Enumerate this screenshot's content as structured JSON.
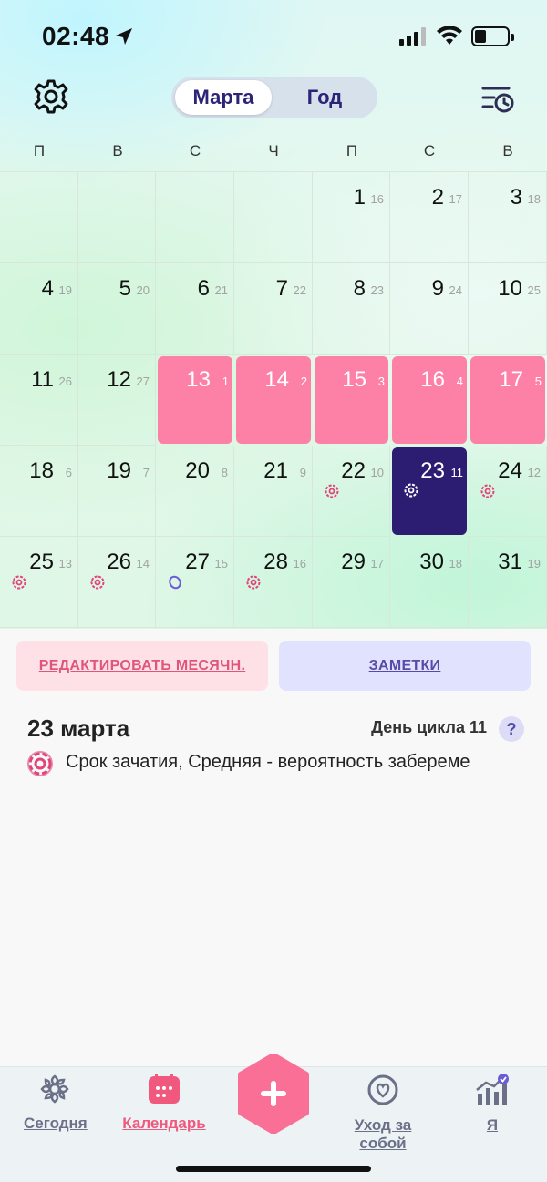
{
  "status": {
    "time": "02:48"
  },
  "header": {
    "segments": [
      {
        "label": "Марта",
        "active": true
      },
      {
        "label": "Год",
        "active": false
      }
    ]
  },
  "weekdays": [
    "П",
    "В",
    "С",
    "Ч",
    "П",
    "С",
    "В"
  ],
  "calendar": {
    "month": "March",
    "accent_period": "#fd80a6",
    "accent_today": "#2d1d72",
    "weeks": [
      [
        null,
        null,
        null,
        null,
        {
          "d": "1",
          "c": "16"
        },
        {
          "d": "2",
          "c": "17"
        },
        {
          "d": "3",
          "c": "18"
        }
      ],
      [
        {
          "d": "4",
          "c": "19"
        },
        {
          "d": "5",
          "c": "20"
        },
        {
          "d": "6",
          "c": "21"
        },
        {
          "d": "7",
          "c": "22"
        },
        {
          "d": "8",
          "c": "23"
        },
        {
          "d": "9",
          "c": "24"
        },
        {
          "d": "10",
          "c": "25"
        }
      ],
      [
        {
          "d": "11",
          "c": "26"
        },
        {
          "d": "12",
          "c": "27"
        },
        {
          "d": "13",
          "c": "1",
          "period": true
        },
        {
          "d": "14",
          "c": "2",
          "period": true
        },
        {
          "d": "15",
          "c": "3",
          "period": true
        },
        {
          "d": "16",
          "c": "4",
          "period": true
        },
        {
          "d": "17",
          "c": "5",
          "period": true
        }
      ],
      [
        {
          "d": "18",
          "c": "6"
        },
        {
          "d": "19",
          "c": "7"
        },
        {
          "d": "20",
          "c": "8"
        },
        {
          "d": "21",
          "c": "9"
        },
        {
          "d": "22",
          "c": "10",
          "marker": "flower"
        },
        {
          "d": "23",
          "c": "11",
          "today": true,
          "marker": "flower"
        },
        {
          "d": "24",
          "c": "12",
          "marker": "flower"
        }
      ],
      [
        {
          "d": "25",
          "c": "13",
          "marker": "flower"
        },
        {
          "d": "26",
          "c": "14",
          "marker": "flower"
        },
        {
          "d": "27",
          "c": "15",
          "marker": "ovulation"
        },
        {
          "d": "28",
          "c": "16",
          "marker": "flower"
        },
        {
          "d": "29",
          "c": "17"
        },
        {
          "d": "30",
          "c": "18"
        },
        {
          "d": "31",
          "c": "19"
        }
      ]
    ]
  },
  "actions": {
    "edit_period": "РЕДАКТИРОВАТЬ МЕСЯЧН.",
    "notes": "ЗАМЕТКИ"
  },
  "day_info": {
    "title": "23 марта",
    "cycle_day": "День цикла 11",
    "help": "?",
    "fertile_text": "Срок зачатия, Средняя - вероятность забереме"
  },
  "tabbar": {
    "items": [
      {
        "label": "Сегодня",
        "icon": "flower-icon",
        "active": false
      },
      {
        "label": "Календарь",
        "icon": "calendar-icon",
        "active": true
      },
      {
        "label": "Уход за собой",
        "icon": "heart-circle-icon",
        "active": false
      },
      {
        "label": "Я",
        "icon": "chart-icon",
        "active": false
      }
    ]
  }
}
